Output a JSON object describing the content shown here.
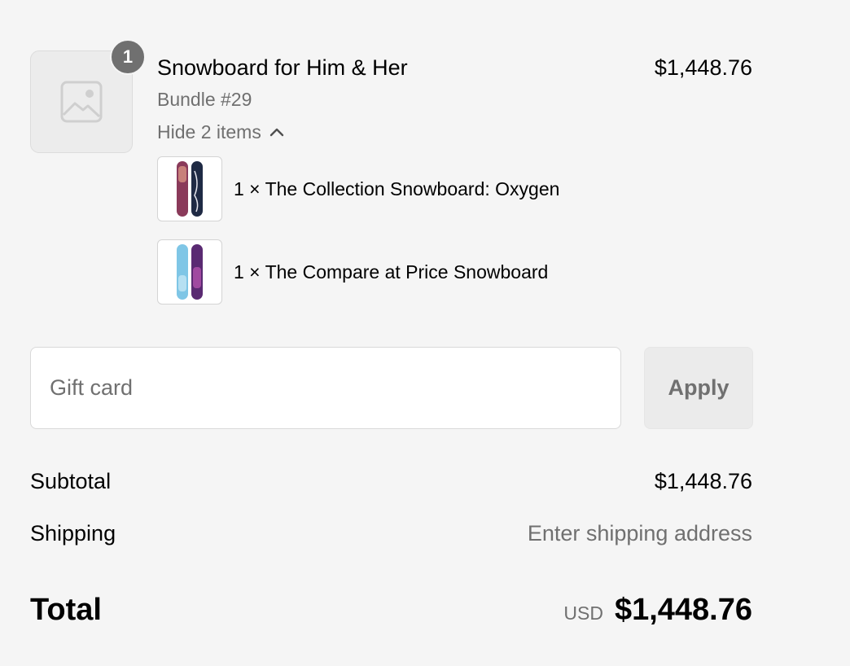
{
  "line_item": {
    "quantity_badge": "1",
    "title": "Snowboard for Him & Her",
    "price": "$1,448.76",
    "variant": "Bundle #29",
    "toggle_label": "Hide 2 items",
    "placeholder_icon": "image-placeholder-icon",
    "bundle_items": [
      {
        "label": "1 × The Collection Snowboard: Oxygen"
      },
      {
        "label": "1 × The Compare at Price Snowboard"
      }
    ]
  },
  "gift_card": {
    "placeholder": "Gift card",
    "value": "",
    "apply_label": "Apply"
  },
  "summary": {
    "subtotal_label": "Subtotal",
    "subtotal_value": "$1,448.76",
    "shipping_label": "Shipping",
    "shipping_value": "Enter shipping address",
    "total_label": "Total",
    "currency": "USD",
    "total_value": "$1,448.76"
  },
  "colors": {
    "background": "#f5f5f5",
    "muted_text": "#707070",
    "badge": "#707070"
  }
}
